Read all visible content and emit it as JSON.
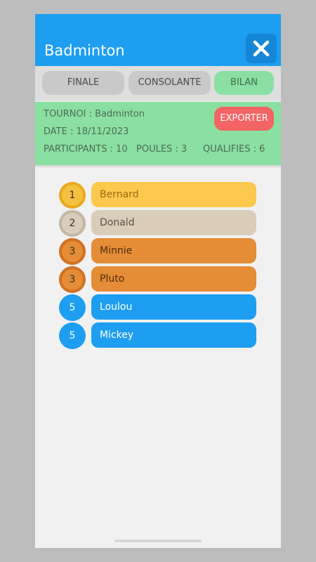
{
  "app": {
    "title": "Badminton"
  },
  "tabs": [
    {
      "label": "FINALE"
    },
    {
      "label": "CONSOLANTE"
    },
    {
      "label": "BILAN"
    }
  ],
  "info": {
    "tournoi": "TOURNOI : Badminton",
    "date": "DATE :  18/11/2023",
    "participants": "PARTICIPANTS : 10",
    "poules": "POULES : 3",
    "qualifies": "QUALIFIES : 6",
    "export_label": "EXPORTER"
  },
  "ranking": [
    {
      "rank": "1",
      "name": "Bernard",
      "medal": "gold"
    },
    {
      "rank": "2",
      "name": "Donald",
      "medal": "silver"
    },
    {
      "rank": "3",
      "name": "Minnie",
      "medal": "bronze"
    },
    {
      "rank": "3",
      "name": "Pluto",
      "medal": "bronze"
    },
    {
      "rank": "5",
      "name": "Loulou",
      "medal": "none"
    },
    {
      "rank": "5",
      "name": "Mickey",
      "medal": "none"
    }
  ],
  "colors": {
    "header": "#1e9ef0",
    "active_tab": "#8ae0a3",
    "export": "#f36464",
    "gold": "#fcc84d",
    "silver": "#d9ccb9",
    "bronze": "#e58c36"
  }
}
